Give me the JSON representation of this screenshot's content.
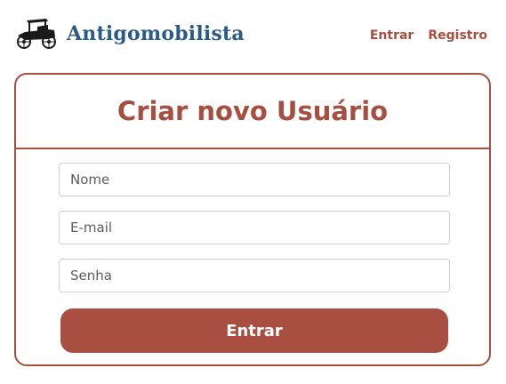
{
  "header": {
    "brand_name": "Antigomobilista",
    "logo_icon": "vintage-car-icon",
    "nav": [
      {
        "label": "Entrar"
      },
      {
        "label": "Registro"
      }
    ]
  },
  "card": {
    "title": "Criar novo Usuário",
    "fields": {
      "name_placeholder": "Nome",
      "email_placeholder": "E-mail",
      "password_placeholder": "Senha"
    },
    "submit_label": "Entrar"
  },
  "colors": {
    "brand_blue": "#2a5a85",
    "accent": "#a64e40",
    "button_bg": "#a94f42",
    "field_border": "#cfcfcf"
  }
}
